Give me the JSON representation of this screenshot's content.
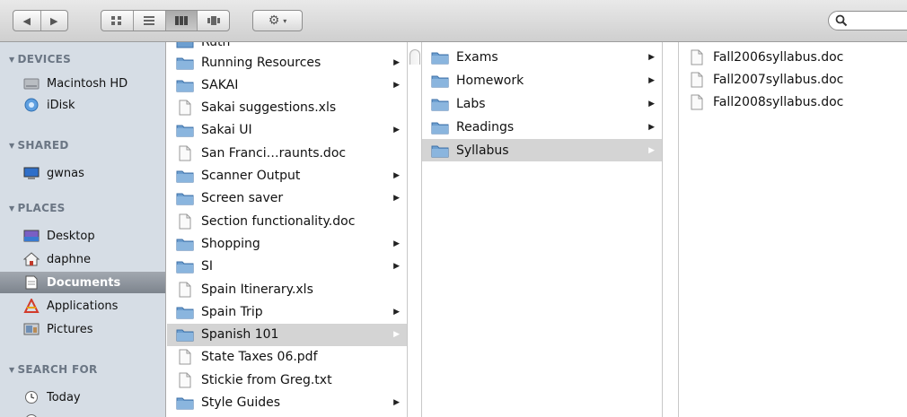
{
  "toolbar": {
    "back_glyph": "◀",
    "forward_glyph": "▶",
    "view_icons": [
      "icon-view-icon",
      "list-view-icon",
      "column-view-icon",
      "coverflow-view-icon"
    ],
    "action_glyph": "⚙",
    "action_caret": "▾"
  },
  "sidebar": {
    "devices": {
      "heading": "DEVICES",
      "items": [
        {
          "label": "Macintosh HD",
          "icon": "hard-drive-icon"
        },
        {
          "label": "iDisk",
          "icon": "idisk-icon"
        }
      ]
    },
    "shared": {
      "heading": "SHARED",
      "items": [
        {
          "label": "gwnas",
          "icon": "network-computer-icon"
        }
      ]
    },
    "places": {
      "heading": "PLACES",
      "items": [
        {
          "label": "Desktop",
          "icon": "desktop-icon"
        },
        {
          "label": "daphne",
          "icon": "home-icon"
        },
        {
          "label": "Documents",
          "icon": "documents-folder-icon",
          "selected": true
        },
        {
          "label": "Applications",
          "icon": "applications-icon"
        },
        {
          "label": "Pictures",
          "icon": "pictures-icon"
        }
      ]
    },
    "search_for": {
      "heading": "SEARCH FOR",
      "items": [
        {
          "label": "Today",
          "icon": "clock-icon"
        }
      ]
    }
  },
  "column1": {
    "partial_top": "Ruth",
    "rows": [
      {
        "label": "Running Resources",
        "type": "folder"
      },
      {
        "label": "SAKAI",
        "type": "folder"
      },
      {
        "label": "Sakai suggestions.xls",
        "type": "file"
      },
      {
        "label": "Sakai UI",
        "type": "folder"
      },
      {
        "label": "San Franci…raunts.doc",
        "type": "file"
      },
      {
        "label": "Scanner Output",
        "type": "folder"
      },
      {
        "label": "Screen saver",
        "type": "folder"
      },
      {
        "label": "Section functionality.doc",
        "type": "file"
      },
      {
        "label": "Shopping",
        "type": "folder"
      },
      {
        "label": "SI",
        "type": "folder"
      },
      {
        "label": "Spain Itinerary.xls",
        "type": "file"
      },
      {
        "label": "Spain Trip",
        "type": "folder"
      },
      {
        "label": "Spanish 101",
        "type": "folder",
        "selected": true
      },
      {
        "label": "State Taxes 06.pdf",
        "type": "file"
      },
      {
        "label": "Stickie from Greg.txt",
        "type": "file"
      },
      {
        "label": "Style Guides",
        "type": "folder"
      }
    ]
  },
  "column2": {
    "rows": [
      {
        "label": "Exams",
        "type": "folder"
      },
      {
        "label": "Homework",
        "type": "folder"
      },
      {
        "label": "Labs",
        "type": "folder"
      },
      {
        "label": "Readings",
        "type": "folder"
      },
      {
        "label": "Syllabus",
        "type": "folder",
        "selected": true
      }
    ]
  },
  "column3": {
    "rows": [
      {
        "label": "Fall2006syllabus.doc",
        "type": "file"
      },
      {
        "label": "Fall2007syllabus.doc",
        "type": "file"
      },
      {
        "label": "Fall2008syllabus.doc",
        "type": "file"
      }
    ]
  },
  "colors": {
    "sidebar_bg": "#d6dde5",
    "selection_gray": "#d4d4d4",
    "folder_blue": "#6d9fd0"
  }
}
